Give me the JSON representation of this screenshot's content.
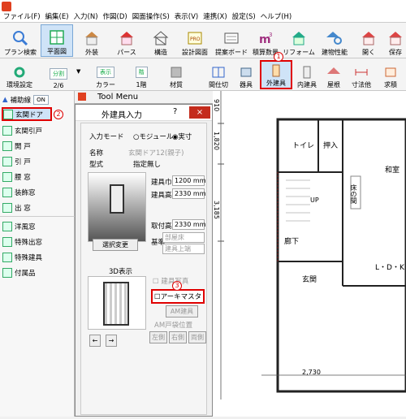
{
  "menubar": {
    "items": [
      "ファイル(F)",
      "編集(E)",
      "入力(N)",
      "作図(D)",
      "図面操作(S)",
      "表示(V)",
      "連携(X)",
      "設定(S)",
      "ヘルプ(H)"
    ]
  },
  "toolbar1": {
    "buttons": [
      "プラン検索",
      "平面図",
      "外装",
      "パース",
      "構造",
      "設計図面",
      "提案ボード",
      "積算数量",
      "リフォーム",
      "建物性能",
      "開く",
      "保存"
    ]
  },
  "toolbar2": {
    "env_label": "環境設定",
    "split_top": "分割",
    "split_bottom": "2/6",
    "display_top": "表示",
    "display_bottom": "カラー",
    "floor_top": "階",
    "floor_bottom": "1階",
    "material_label": "材質",
    "right_buttons": [
      "間仕切",
      "器具",
      "外建具",
      "内建具",
      "屋根",
      "寸法他",
      "求積"
    ]
  },
  "sidebar": {
    "aux_label": "補助線",
    "aux_toggle": "ON",
    "items": [
      "玄関ドア",
      "玄関引戸",
      "開 戸",
      "引 戸",
      "腰 窓",
      "装飾窓",
      "出 窓",
      "洋風窓",
      "特殊出窓",
      "特殊建具",
      "付属品"
    ]
  },
  "tool_menu": {
    "title": "Tool Menu"
  },
  "dialog": {
    "title": "外建具入力",
    "help": "?",
    "close": "×",
    "input_mode_label": "入力モード",
    "radio_module": "モジュール",
    "radio_actual": "実寸",
    "name_label": "名称",
    "name_value": "玄関ドア12(親子)",
    "type_label": "型式",
    "type_value": "指定無し",
    "width_label": "建具巾",
    "width_value": "1200 mm",
    "height_label": "建具高",
    "height_value": "2330 mm",
    "mount_label": "取付高",
    "mount_value": "2330 mm",
    "base_label": "基準",
    "base_option1": "部屋床",
    "base_option2": "建具上端",
    "select_change": "選択変更",
    "view3d": "3D表示",
    "photo_check": "建具写真",
    "archimaster_check": "アーキマスタ",
    "am_button": "AM建具",
    "am_position": "AM戸袋位置",
    "left_side": "左側",
    "right_side": "右側",
    "both_sides": "両側",
    "arrow_left": "←",
    "arrow_right": "→"
  },
  "canvas": {
    "dim_top": "910",
    "dim_mid": "1,820",
    "dim_low": "3,185",
    "dim_bottom": "2,730",
    "room_toilet": "トイレ",
    "room_closet": "押入",
    "room_washitsu": "和室",
    "room_tokonoma": "床の間",
    "room_hall": "廊下",
    "room_entrance": "玄関",
    "room_ldk": "L・D・K",
    "stair_up": "UP"
  },
  "annotations": {
    "n1": "1",
    "n2": "2",
    "n3": "3"
  },
  "colors": {
    "highlight": "#e00000",
    "active_button": "#cfe3f7"
  }
}
